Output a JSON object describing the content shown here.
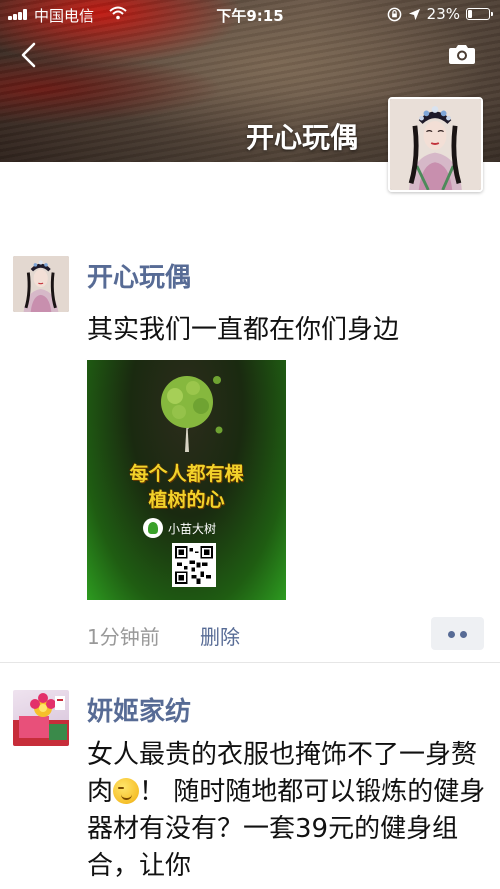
{
  "status_bar": {
    "carrier": "中国电信",
    "time": "下午9:15",
    "battery_text": "23%",
    "battery_level": 0.23
  },
  "cover": {
    "name": "开心玩偶",
    "back_icon": "chevron-left-icon",
    "camera_icon": "camera-icon"
  },
  "posts": [
    {
      "author": "开心玩偶",
      "text": "其实我们一直都在你们身边",
      "image": {
        "line1": "每个人都有棵",
        "line2": "植树的心",
        "brand": "小苗大树"
      },
      "time": "1分钟前",
      "delete_label": "删除"
    },
    {
      "author": "妍姬家纺",
      "text_before_emoji": "女人最贵的衣服也掩饰不了一身赘肉",
      "text_after_emoji": "！ 随时随地都可以锻炼的健身器材有没有？一套39元的健身组合，让你"
    }
  ]
}
